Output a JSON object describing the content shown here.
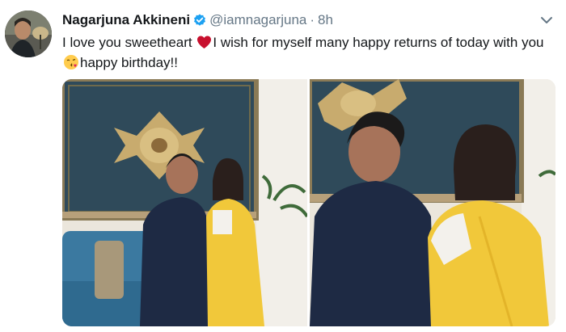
{
  "tweet": {
    "display_name": "Nagarjuna Akkineni",
    "handle": "@iamnagarjuna",
    "separator": "·",
    "time": "8h",
    "text_part1": "I love you sweetheart ",
    "text_part2": "I wish for myself many happy returns of today with you",
    "text_part3": "happy birthday!!",
    "emoji": [
      "red-heart-icon",
      "face-blowing-kiss-icon"
    ]
  },
  "colors": {
    "text": "#14171a",
    "secondary": "#657786",
    "verified": "#1da1f2",
    "heart": "#e0245e"
  },
  "media": [
    "photo-couple-sofa",
    "photo-couple-closeup"
  ]
}
